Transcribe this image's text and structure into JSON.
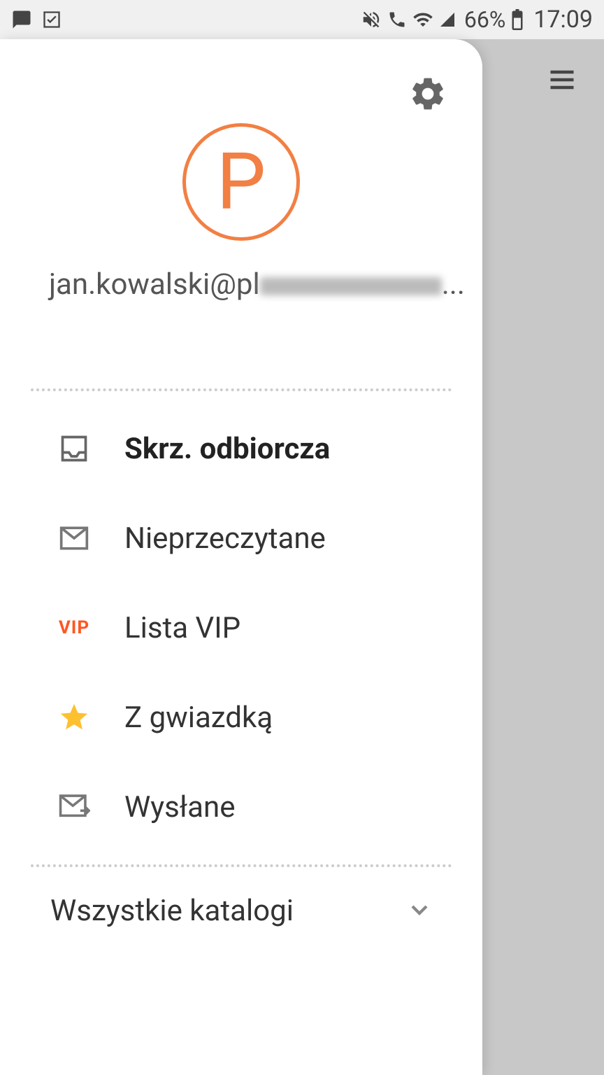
{
  "statusbar": {
    "battery_percent": "66%",
    "time": "17:09"
  },
  "drawer": {
    "avatar_letter": "P",
    "email_visible": "jan.kowalski@pl",
    "email_suffix": "...",
    "nav": [
      {
        "label": "Skrz. odbiorcza",
        "icon": "inbox-icon",
        "bold": true
      },
      {
        "label": "Nieprzeczytane",
        "icon": "mail-icon",
        "bold": false
      },
      {
        "label": "Lista VIP",
        "icon": "vip-icon",
        "bold": false
      },
      {
        "label": "Z gwiazdką",
        "icon": "star-icon",
        "bold": false
      },
      {
        "label": "Wysłane",
        "icon": "sent-icon",
        "bold": false
      }
    ],
    "all_folders_label": "Wszystkie katalogi"
  },
  "colors": {
    "accent": "#f27f43",
    "star": "#fdc02f",
    "vip": "#ff5722"
  }
}
